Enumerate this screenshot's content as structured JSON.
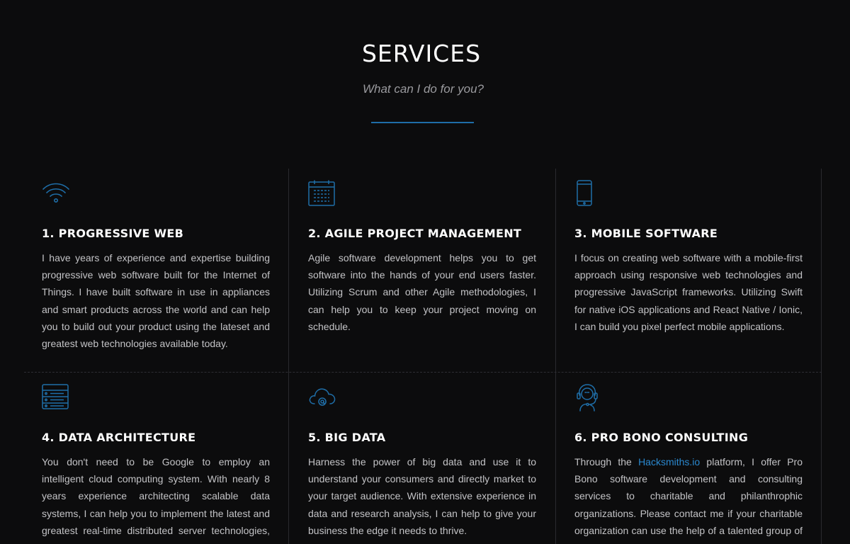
{
  "section": {
    "title": "SERVICES",
    "subtitle": "What can I do for you?",
    "accent_color": "#1f6ea8"
  },
  "services": [
    {
      "title": "1. PROGRESSIVE WEB",
      "icon": "wifi-icon",
      "text": "I have years of experience and expertise building progressive web software built for the Internet of Things. I have built software in use in appliances and smart products across the world and can help you to build out your product using the lateset and greatest web technologies available today."
    },
    {
      "title": "2. AGILE PROJECT MANAGEMENT",
      "icon": "calendar-icon",
      "text": "Agile software development helps you to get software into the hands of your end users faster. Utilizing Scrum and other Agile methodologies, I can help you to keep your project moving on schedule."
    },
    {
      "title": "3. MOBILE SOFTWARE",
      "icon": "mobile-phone-icon",
      "text": "I focus on creating web software with a mobile-first approach using responsive web technologies and progressive JavaScript frameworks. Utilizing Swift for native iOS applications and React Native / Ionic, I can build you pixel perfect mobile applications."
    },
    {
      "title": "4. DATA ARCHITECTURE",
      "icon": "server-icon",
      "text": "You don't need to be Google to employ an intelligent cloud computing system. With nearly 8 years experience architecting scalable data systems, I can help you to implement the latest and greatest real-time distributed server technologies, including Docker, MongoDB, SQL,"
    },
    {
      "title": "5. BIG DATA",
      "icon": "cloud-at-icon",
      "text": "Harness the power of big data and use it to understand your consumers and directly market to your target audience. With extensive experience in data and research analysis, I can help to give your business the edge it needs to thrive."
    },
    {
      "title": "6. PRO BONO CONSULTING",
      "icon": "headset-support-icon",
      "text_before": "Through the ",
      "link_text": "Hacksmiths.io",
      "text_after": " platform, I offer Pro Bono software development and consulting services to charitable and philanthrophic organizations. Please contact me if your charitable organization can use the help of a talented group of professional software"
    }
  ],
  "colors": {
    "background": "#0c0c0d",
    "icon": "#1f6ea8",
    "link": "#2a88cf",
    "body_text": "#c3c3c6"
  }
}
